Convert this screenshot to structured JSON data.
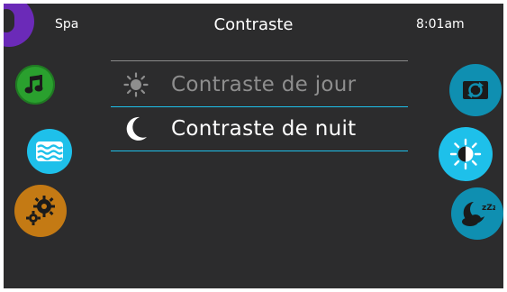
{
  "header": {
    "left_label": "Spa",
    "title": "Contraste",
    "time": "8:01am"
  },
  "menu": {
    "items": [
      {
        "label": "Contraste de jour",
        "icon": "sun-icon",
        "selected": false
      },
      {
        "label": "Contraste de nuit",
        "icon": "moon-icon",
        "selected": true
      }
    ]
  },
  "left_nav": {
    "icons": [
      "home-icon",
      "music-icon",
      "water-icon",
      "settings-icon"
    ]
  },
  "right_nav": {
    "icons": [
      "screen-rotate-icon",
      "day-contrast-icon",
      "night-contrast-icon"
    ]
  },
  "colors": {
    "background": "#2c2c2d",
    "accent_blue": "#1ec0ea",
    "teal": "#0f8fb1",
    "green": "#2aa02e",
    "orange": "#c47a14",
    "purple": "#6b2ab8",
    "dim_text": "#8e8e8e"
  }
}
